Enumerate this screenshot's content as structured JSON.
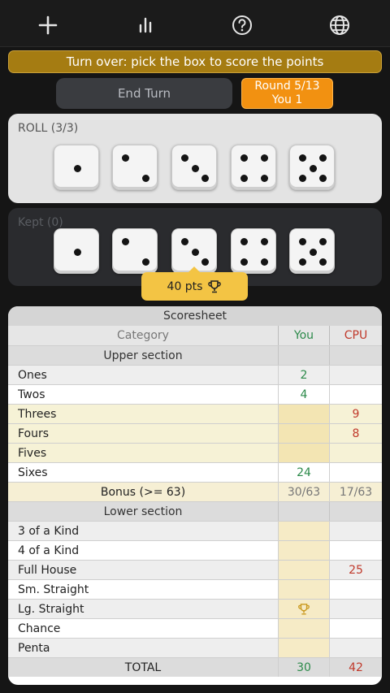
{
  "toolbar": {
    "icons": [
      "plus-icon",
      "bar-chart-icon",
      "help-icon",
      "globe-icon"
    ]
  },
  "banner": "Turn over: pick the box to score the points",
  "controls": {
    "end_turn_label": "End Turn",
    "round_label": "Round 5/13",
    "player_label": "You 1"
  },
  "roll": {
    "label": "ROLL (3/3)",
    "dice": [
      1,
      2,
      3,
      4,
      5
    ]
  },
  "kept": {
    "label": "Kept (0)",
    "dice": [
      1,
      2,
      3,
      4,
      5
    ]
  },
  "points_popup": "40 pts",
  "scoresheet": {
    "title": "Scoresheet",
    "headers": {
      "category": "Category",
      "you": "You",
      "cpu": "CPU"
    },
    "upper_title": "Upper section",
    "upper": [
      {
        "name": "Ones",
        "you": "2",
        "cpu": ""
      },
      {
        "name": "Twos",
        "you": "4",
        "cpu": ""
      },
      {
        "name": "Threes",
        "you": "",
        "cpu": "9"
      },
      {
        "name": "Fours",
        "you": "",
        "cpu": "8"
      },
      {
        "name": "Fives",
        "you": "",
        "cpu": ""
      },
      {
        "name": "Sixes",
        "you": "24",
        "cpu": ""
      }
    ],
    "bonus": {
      "name": "Bonus (>= 63)",
      "you": "30/63",
      "cpu": "17/63"
    },
    "lower_title": "Lower section",
    "lower": [
      {
        "name": "3 of a Kind",
        "you": "",
        "cpu": ""
      },
      {
        "name": "4 of a Kind",
        "you": "",
        "cpu": ""
      },
      {
        "name": "Full House",
        "you": "",
        "cpu": "25"
      },
      {
        "name": "Sm. Straight",
        "you": "",
        "cpu": ""
      },
      {
        "name": "Lg. Straight",
        "you": "",
        "cpu": ""
      },
      {
        "name": "Chance",
        "you": "",
        "cpu": ""
      },
      {
        "name": "Penta",
        "you": "",
        "cpu": ""
      }
    ],
    "total": {
      "name": "TOTAL",
      "you": "30",
      "cpu": "42"
    }
  },
  "colors": {
    "banner": "#a57c12",
    "round": "#f29111",
    "you": "#2c8a4a",
    "cpu": "#c0392b",
    "popup": "#f3c444"
  }
}
